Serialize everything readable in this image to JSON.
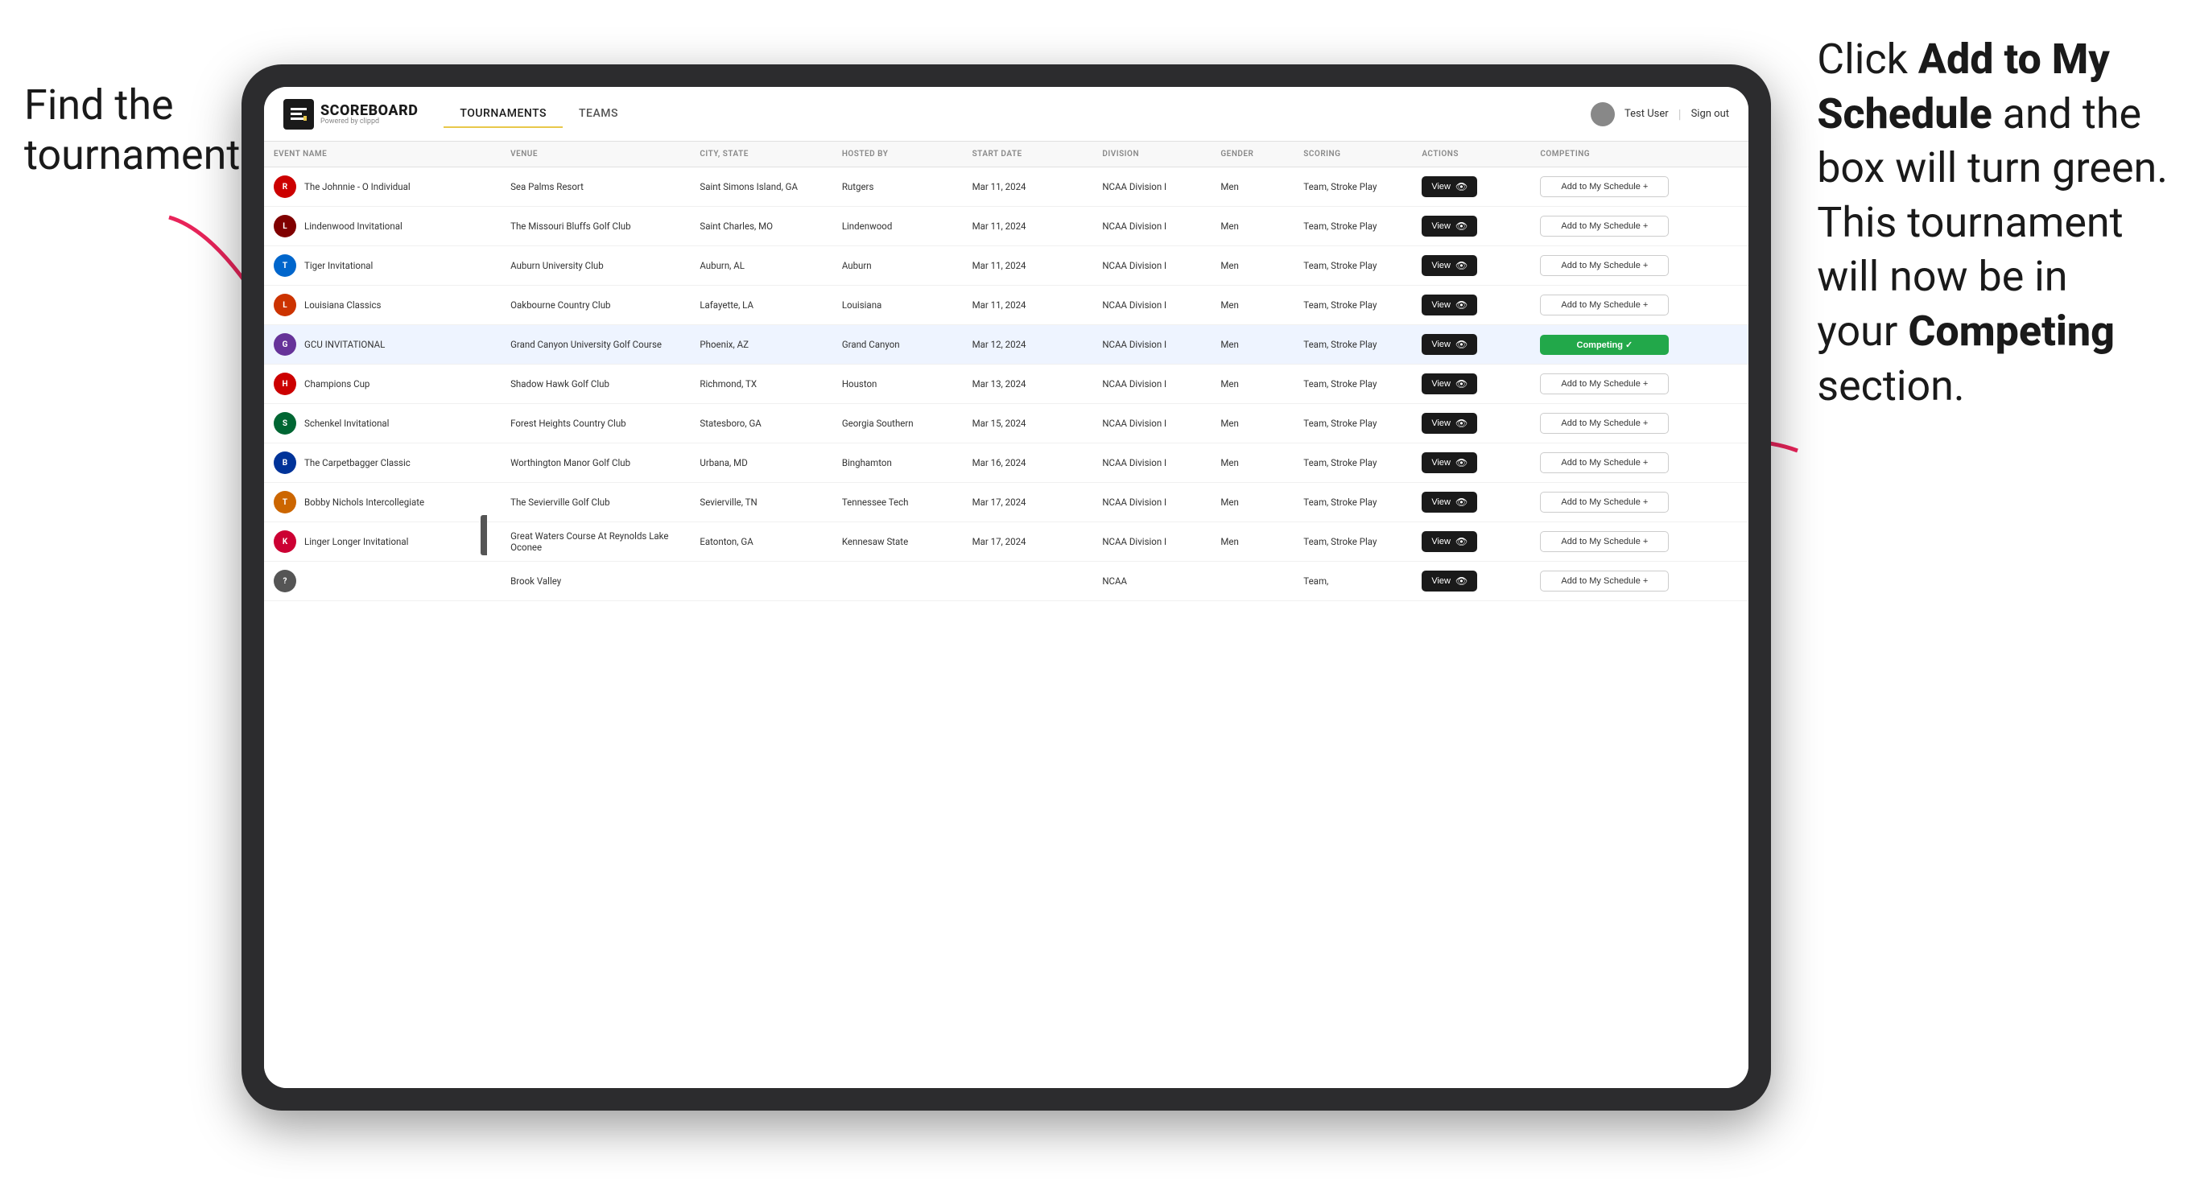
{
  "annotations": {
    "left_text": "Find the\ntournament.",
    "right_line1": "Click ",
    "right_bold1": "Add to My\nSchedule",
    "right_line2": " and the\nbox will turn green.\nThis tournament\nwill now be in\nyour ",
    "right_bold2": "Competing",
    "right_line3": "\nsection."
  },
  "app": {
    "logo_text": "SCOREBOARD",
    "logo_sub": "Powered by clippd",
    "nav_tabs": [
      "TOURNAMENTS",
      "TEAMS"
    ],
    "active_tab": "TOURNAMENTS",
    "user": "Test User",
    "sign_out": "Sign out"
  },
  "table": {
    "columns": [
      "EVENT NAME",
      "VENUE",
      "CITY, STATE",
      "HOSTED BY",
      "START DATE",
      "DIVISION",
      "GENDER",
      "SCORING",
      "ACTIONS",
      "COMPETING"
    ],
    "rows": [
      {
        "id": 1,
        "logo_color": "#cc0000",
        "logo_letter": "R",
        "event_name": "The Johnnie - O Individual",
        "venue": "Sea Palms Resort",
        "city_state": "Saint Simons Island, GA",
        "hosted_by": "Rutgers",
        "start_date": "Mar 11, 2024",
        "division": "NCAA Division I",
        "gender": "Men",
        "scoring": "Team, Stroke Play",
        "competing_status": "add"
      },
      {
        "id": 2,
        "logo_color": "#800000",
        "logo_letter": "L",
        "event_name": "Lindenwood Invitational",
        "venue": "The Missouri Bluffs Golf Club",
        "city_state": "Saint Charles, MO",
        "hosted_by": "Lindenwood",
        "start_date": "Mar 11, 2024",
        "division": "NCAA Division I",
        "gender": "Men",
        "scoring": "Team, Stroke Play",
        "competing_status": "add"
      },
      {
        "id": 3,
        "logo_color": "#0066cc",
        "logo_letter": "T",
        "event_name": "Tiger Invitational",
        "venue": "Auburn University Club",
        "city_state": "Auburn, AL",
        "hosted_by": "Auburn",
        "start_date": "Mar 11, 2024",
        "division": "NCAA Division I",
        "gender": "Men",
        "scoring": "Team, Stroke Play",
        "competing_status": "add"
      },
      {
        "id": 4,
        "logo_color": "#cc3300",
        "logo_letter": "L",
        "event_name": "Louisiana Classics",
        "venue": "Oakbourne Country Club",
        "city_state": "Lafayette, LA",
        "hosted_by": "Louisiana",
        "start_date": "Mar 11, 2024",
        "division": "NCAA Division I",
        "gender": "Men",
        "scoring": "Team, Stroke Play",
        "competing_status": "add"
      },
      {
        "id": 5,
        "logo_color": "#663399",
        "logo_letter": "G",
        "event_name": "GCU INVITATIONAL",
        "venue": "Grand Canyon University Golf Course",
        "city_state": "Phoenix, AZ",
        "hosted_by": "Grand Canyon",
        "start_date": "Mar 12, 2024",
        "division": "NCAA Division I",
        "gender": "Men",
        "scoring": "Team, Stroke Play",
        "competing_status": "competing",
        "highlighted": true
      },
      {
        "id": 6,
        "logo_color": "#cc0000",
        "logo_letter": "H",
        "event_name": "Champions Cup",
        "venue": "Shadow Hawk Golf Club",
        "city_state": "Richmond, TX",
        "hosted_by": "Houston",
        "start_date": "Mar 13, 2024",
        "division": "NCAA Division I",
        "gender": "Men",
        "scoring": "Team, Stroke Play",
        "competing_status": "add"
      },
      {
        "id": 7,
        "logo_color": "#006633",
        "logo_letter": "S",
        "event_name": "Schenkel Invitational",
        "venue": "Forest Heights Country Club",
        "city_state": "Statesboro, GA",
        "hosted_by": "Georgia Southern",
        "start_date": "Mar 15, 2024",
        "division": "NCAA Division I",
        "gender": "Men",
        "scoring": "Team, Stroke Play",
        "competing_status": "add"
      },
      {
        "id": 8,
        "logo_color": "#003399",
        "logo_letter": "B",
        "event_name": "The Carpetbagger Classic",
        "venue": "Worthington Manor Golf Club",
        "city_state": "Urbana, MD",
        "hosted_by": "Binghamton",
        "start_date": "Mar 16, 2024",
        "division": "NCAA Division I",
        "gender": "Men",
        "scoring": "Team, Stroke Play",
        "competing_status": "add"
      },
      {
        "id": 9,
        "logo_color": "#cc6600",
        "logo_letter": "T",
        "event_name": "Bobby Nichols Intercollegiate",
        "venue": "The Sevierville Golf Club",
        "city_state": "Sevierville, TN",
        "hosted_by": "Tennessee Tech",
        "start_date": "Mar 17, 2024",
        "division": "NCAA Division I",
        "gender": "Men",
        "scoring": "Team, Stroke Play",
        "competing_status": "add"
      },
      {
        "id": 10,
        "logo_color": "#cc0033",
        "logo_letter": "K",
        "event_name": "Linger Longer Invitational",
        "venue": "Great Waters Course At Reynolds Lake Oconee",
        "city_state": "Eatonton, GA",
        "hosted_by": "Kennesaw State",
        "start_date": "Mar 17, 2024",
        "division": "NCAA Division I",
        "gender": "Men",
        "scoring": "Team, Stroke Play",
        "competing_status": "add"
      },
      {
        "id": 11,
        "logo_color": "#555555",
        "logo_letter": "?",
        "event_name": "",
        "venue": "Brook Valley",
        "city_state": "",
        "hosted_by": "",
        "start_date": "",
        "division": "NCAA",
        "gender": "",
        "scoring": "Team,",
        "competing_status": "add"
      }
    ],
    "view_label": "View",
    "add_label": "Add to My Schedule +",
    "competing_label": "Competing ✓"
  }
}
